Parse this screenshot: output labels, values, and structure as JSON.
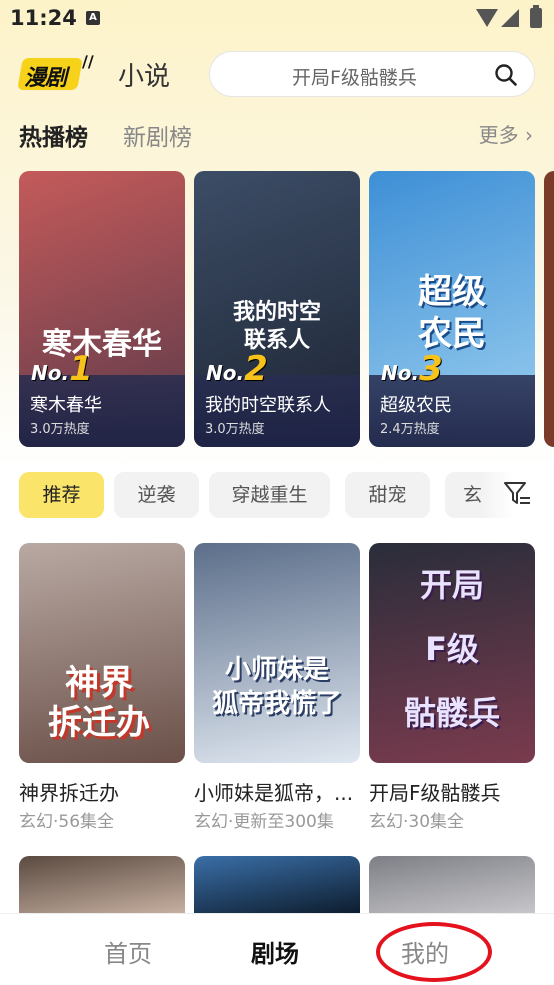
{
  "status": {
    "time": "11:24",
    "notification_icon": "A"
  },
  "header": {
    "logo_text": "漫剧",
    "novel_tab": "小说",
    "search_placeholder": "开局F级骷髅兵"
  },
  "ranking": {
    "tab_hot": "热播榜",
    "tab_new": "新剧榜",
    "more": "更多 ›",
    "items": [
      {
        "rank_prefix": "No.",
        "rank": "1",
        "title": "寒木春华",
        "art_title": "寒木春华",
        "heat": "3.0万热度",
        "art_colors": [
          "#c45a5a",
          "#5b3a4a"
        ]
      },
      {
        "rank_prefix": "No.",
        "rank": "2",
        "title": "我的时空联系人",
        "art_title": "我的时空\n联系人",
        "heat": "3.0万热度",
        "art_colors": [
          "#3c4d66",
          "#1d2433"
        ]
      },
      {
        "rank_prefix": "No.",
        "rank": "3",
        "title": "超级农民",
        "art_title": "超级\n农民",
        "heat": "2.4万热度",
        "art_colors": [
          "#3e8fd6",
          "#9cd0f0"
        ]
      }
    ]
  },
  "categories": [
    "推荐",
    "逆袭",
    "穿越重生",
    "甜宠",
    "玄"
  ],
  "grid": [
    {
      "title": "神界拆迁办",
      "meta": "玄幻·56集全",
      "art_title": "神界\n拆迁办",
      "art_colors": [
        "#b9a9a3",
        "#6a5048"
      ]
    },
    {
      "title": "小师妹是狐帝，...",
      "meta": "玄幻·更新至300集",
      "art_title": "小师妹是\n狐帝我慌了",
      "art_colors": [
        "#5c6e8a",
        "#dfe7f0"
      ]
    },
    {
      "title": "开局F级骷髅兵",
      "meta": "玄幻·30集全",
      "art_title": "开局\nF级\n骷髅兵",
      "art_colors": [
        "#2a2d3a",
        "#7a3b4e"
      ]
    }
  ],
  "row2_colors": [
    [
      "#5b4a40",
      "#c9b3a4"
    ],
    [
      "#3a6fa8",
      "#0c1a2a"
    ],
    [
      "#7e7f86",
      "#c9c9cc"
    ]
  ],
  "bottom_nav": {
    "home": "首页",
    "theater": "剧场",
    "mine": "我的"
  }
}
